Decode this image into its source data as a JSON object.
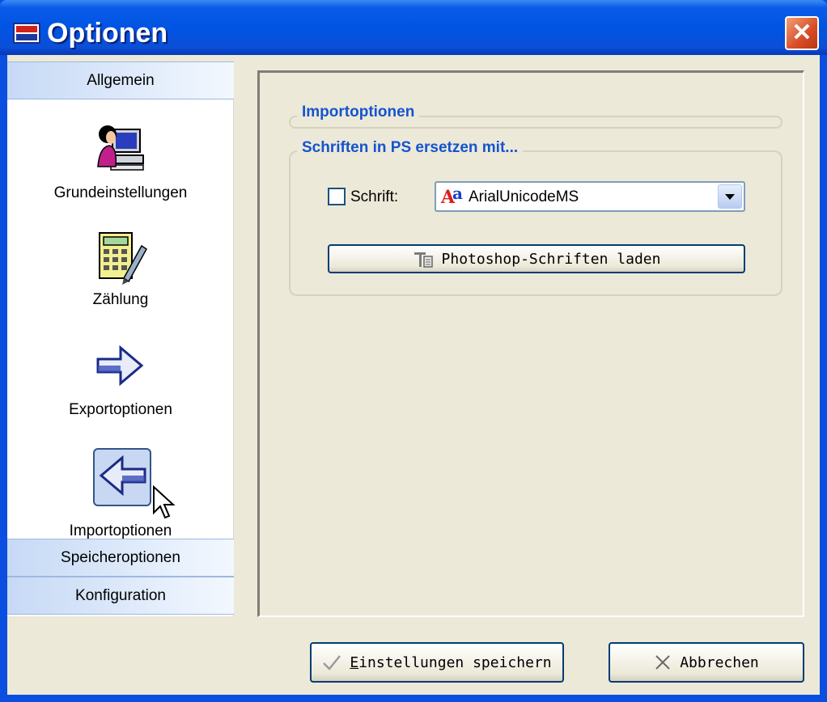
{
  "window": {
    "title": "Optionen",
    "close_glyph": "✕"
  },
  "sidebar": {
    "top_section": "Allgemein",
    "items": [
      {
        "label": "Grundeinstellungen",
        "icon": "person-computer-icon"
      },
      {
        "label": "Zählung",
        "icon": "calculator-pen-icon"
      },
      {
        "label": "Exportoptionen",
        "icon": "arrow-right-icon"
      },
      {
        "label": "Importoptionen",
        "icon": "arrow-left-icon",
        "selected": true
      }
    ],
    "bottom_sections": [
      "Speicheroptionen",
      "Konfiguration"
    ]
  },
  "content": {
    "group1_title": "Importoptionen",
    "group2_title": "Schriften in PS ersetzen mit...",
    "checkbox_label": "Schrift:",
    "checkbox_checked": false,
    "font_select_value": "ArialUnicodeMS",
    "load_fonts_button": "Photoshop-Schriften laden"
  },
  "footer": {
    "save_button": "Einstellungen speichern",
    "save_mnemonic": "E",
    "cancel_button": "Abbrechen"
  },
  "colors": {
    "titlebar": "#0054e3",
    "group_title": "#1454d0",
    "dialog_bg": "#ece9d8"
  }
}
